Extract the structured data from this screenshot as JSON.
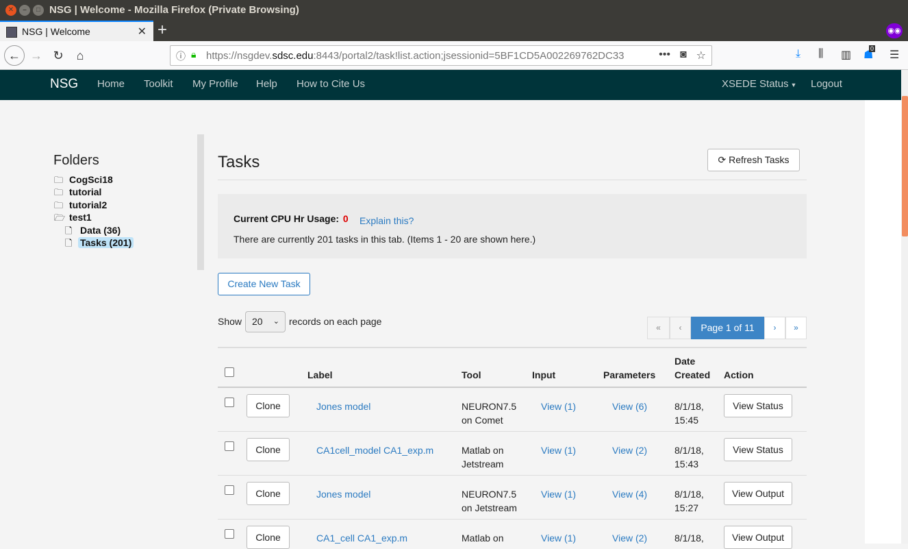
{
  "browser": {
    "window_title": "NSG | Welcome - Mozilla Firefox (Private Browsing)",
    "tab_title": "NSG | Welcome",
    "url_prefix": "https://nsgdev.",
    "url_domain": "sdsc.edu",
    "url_rest": ":8443/portal2/task!list.action;jsessionid=5BF1CD5A002269762DC33",
    "notification_count": "0"
  },
  "site_nav": {
    "brand": "NSG",
    "links": [
      "Home",
      "Toolkit",
      "My Profile",
      "Help",
      "How to Cite Us"
    ],
    "xsede_status": "XSEDE Status",
    "logout": "Logout"
  },
  "sidebar": {
    "title": "Folders",
    "folders": [
      {
        "label": "CogSci18",
        "icon": "folder-icon"
      },
      {
        "label": "tutorial",
        "icon": "folder-icon"
      },
      {
        "label": "tutorial2",
        "icon": "folder-icon"
      },
      {
        "label": "test1",
        "icon": "folder-open-icon"
      }
    ],
    "subfolders": [
      {
        "label": "Data (36)",
        "icon": "file-icon"
      },
      {
        "label": "Tasks (201)",
        "icon": "file-icon",
        "selected": true
      }
    ]
  },
  "main": {
    "title": "Tasks",
    "refresh_label": "Refresh Tasks",
    "cpu_label": "Current CPU Hr Usage:",
    "cpu_value": "0",
    "explain": "Explain this?",
    "tasks_count": "There are currently 201 tasks in this tab. (Items 1 - 20 are shown here.)",
    "create_label": "Create New Task",
    "show_label": "Show",
    "records_value": "20",
    "records_label": "records on each page",
    "pager": {
      "first": "«",
      "prev": "‹",
      "page": "Page 1 of 11",
      "next": "›",
      "last": "»"
    }
  },
  "table": {
    "headers": {
      "label": "Label",
      "tool": "Tool",
      "input": "Input",
      "parameters": "Parameters",
      "date_line1": "Date",
      "date_line2": "Created",
      "action": "Action"
    },
    "clone_label": "Clone",
    "rows": [
      {
        "label": "Jones model",
        "tool1": "NEURON7.5",
        "tool2": "on Comet",
        "input": "View (1)",
        "params": "View (6)",
        "date1": "8/1/18,",
        "date2": "15:45",
        "action": "View Status"
      },
      {
        "label": "CA1cell_model CA1_exp.m",
        "tool1": "Matlab on",
        "tool2": "Jetstream",
        "input": "View (1)",
        "params": "View (2)",
        "date1": "8/1/18,",
        "date2": "15:43",
        "action": "View Status"
      },
      {
        "label": "Jones model",
        "tool1": "NEURON7.5",
        "tool2": "on Jetstream",
        "input": "View (1)",
        "params": "View (4)",
        "date1": "8/1/18,",
        "date2": "15:27",
        "action": "View Output"
      },
      {
        "label": "CA1_cell CA1_exp.m",
        "tool1": "Matlab on",
        "tool2": "",
        "input": "View (1)",
        "params": "View (2)",
        "date1": "8/1/18,",
        "date2": "",
        "action": "View Output"
      }
    ]
  }
}
